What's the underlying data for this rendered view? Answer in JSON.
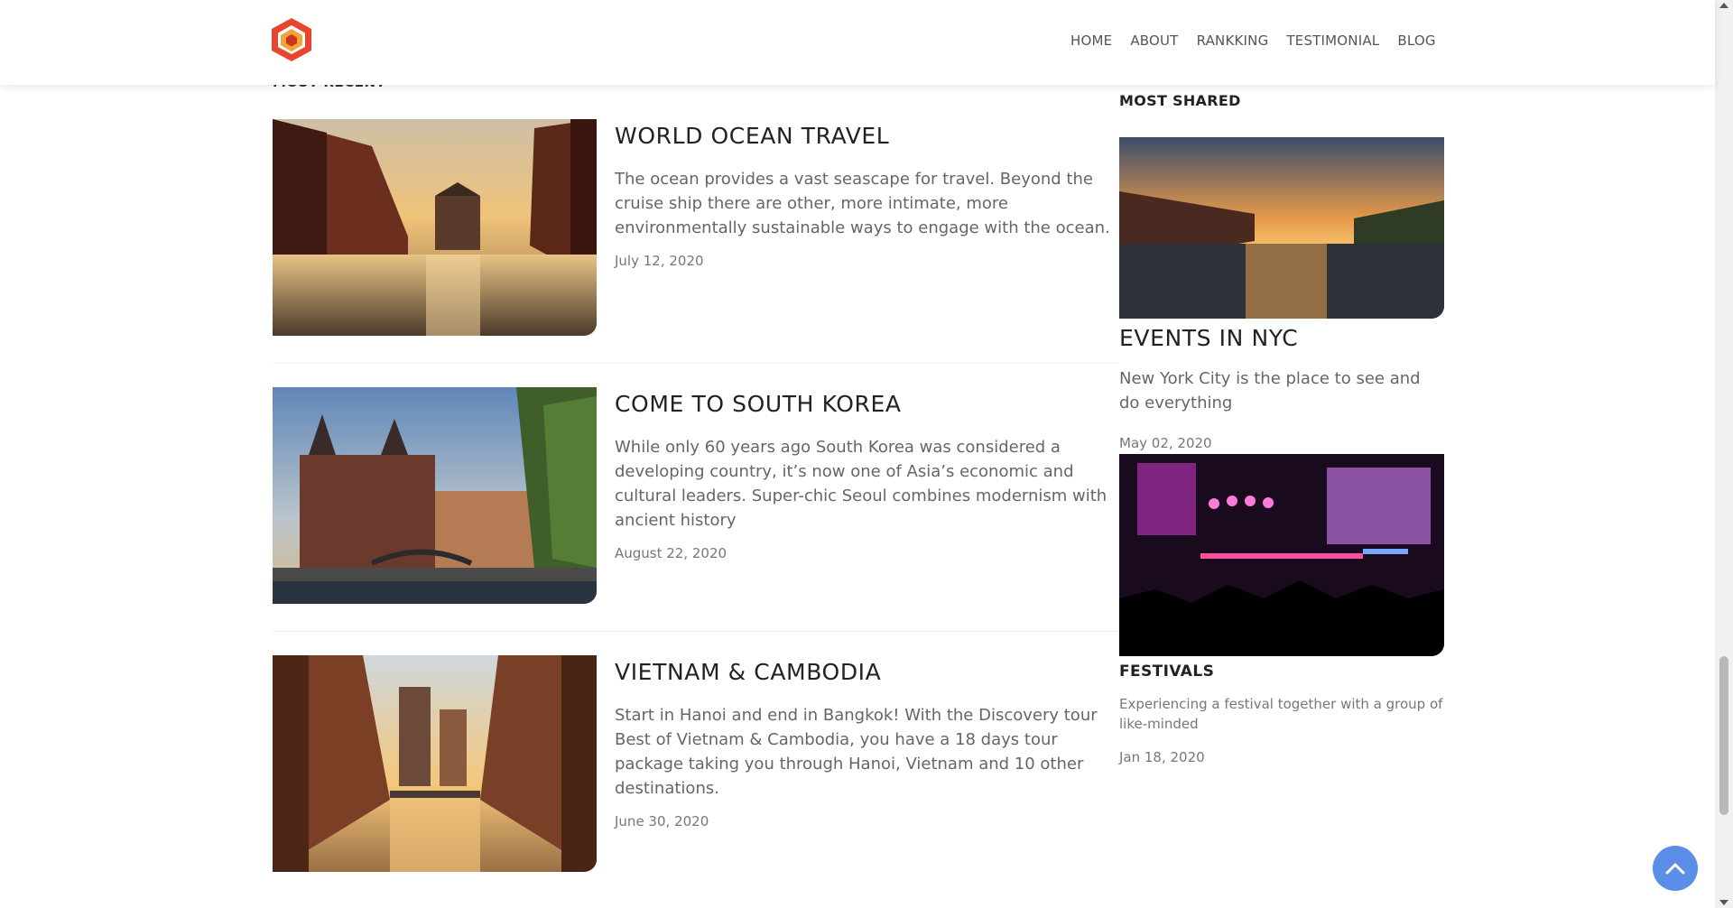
{
  "nav": {
    "items": [
      {
        "label": "HOME"
      },
      {
        "label": "ABOUT"
      },
      {
        "label": "RANKKING"
      },
      {
        "label": "TESTIMONIAL"
      },
      {
        "label": "BLOG"
      }
    ]
  },
  "main": {
    "section_label": "MOST RECENT",
    "posts": [
      {
        "title": "WORLD OCEAN TRAVEL",
        "description": "The ocean provides a vast seascape for travel. Beyond the cruise ship there are other, more intimate, more environmentally sustainable ways to engage with the ocean.",
        "date": "July 12, 2020"
      },
      {
        "title": "COME TO SOUTH KOREA",
        "description": "While only 60 years ago South Korea was considered a developing country, it’s now one of Asia’s economic and cultural leaders. Super-chic Seoul combines modernism with ancient history",
        "date": "August 22, 2020"
      },
      {
        "title": "VIETNAM & CAMBODIA",
        "description": "Start in Hanoi and end in Bangkok! With the Discovery tour Best of Vietnam & Cambodia, you have a 18 days tour package taking you through Hanoi, Vietnam and 10 other destinations.",
        "date": "June 30, 2020"
      }
    ]
  },
  "sidebar": {
    "label": "MOST SHARED",
    "featured": {
      "title": "EVENTS IN NYC",
      "description": "New York City is the place to see and do everything",
      "date": "May 02, 2020"
    },
    "second": {
      "title": "FESTIVALS",
      "description": "Experiencing a festival together with a group of like-minded",
      "date": "Jan 18, 2020"
    }
  },
  "colors": {
    "accent": "#5b8ee6",
    "logo_outer": "#e8452c",
    "logo_inner": "#f2a33a"
  }
}
